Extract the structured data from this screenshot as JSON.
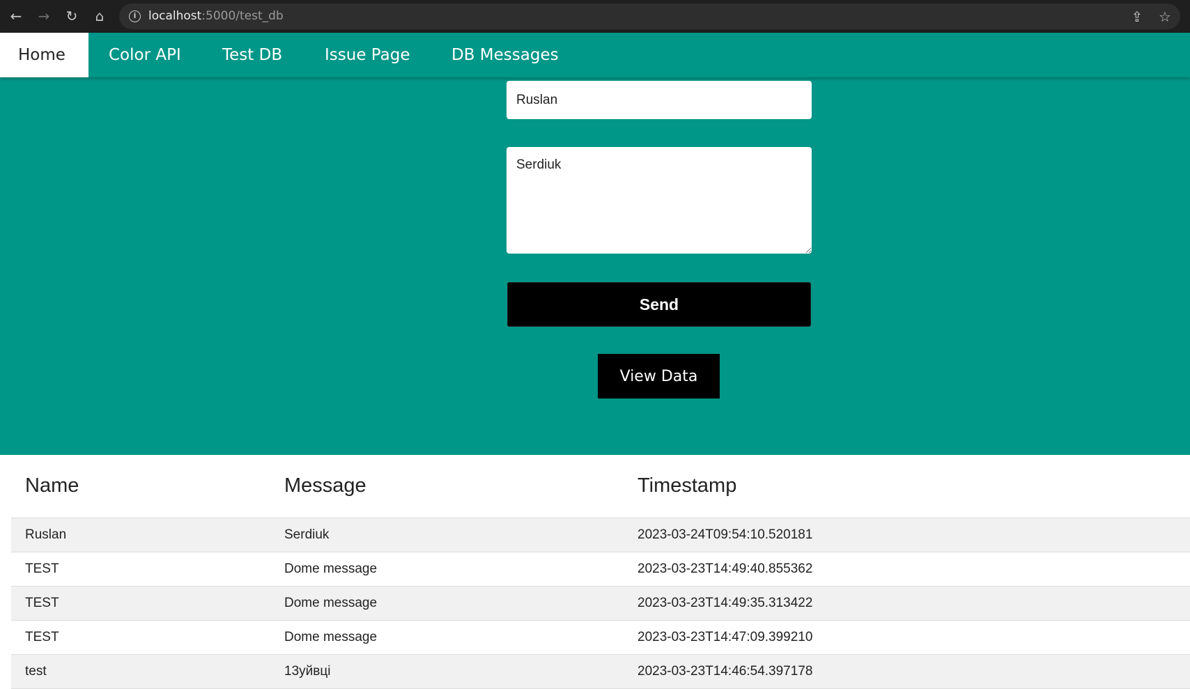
{
  "browser": {
    "url_host": "localhost",
    "url_path": ":5000/test_db"
  },
  "nav": {
    "items": [
      {
        "label": "Home"
      },
      {
        "label": "Color API"
      },
      {
        "label": "Test DB"
      },
      {
        "label": "Issue Page"
      },
      {
        "label": "DB Messages"
      }
    ]
  },
  "form": {
    "name_value": "Ruslan",
    "message_value": "Serdiuk",
    "send_label": "Send",
    "view_label": "View Data"
  },
  "table": {
    "headers": [
      "Name",
      "Message",
      "Timestamp"
    ],
    "rows": [
      [
        "Ruslan",
        "Serdiuk",
        "2023-03-24T09:54:10.520181"
      ],
      [
        "TEST",
        "Dome message",
        "2023-03-23T14:49:40.855362"
      ],
      [
        "TEST",
        "Dome message",
        "2023-03-23T14:49:35.313422"
      ],
      [
        "TEST",
        "Dome message",
        "2023-03-23T14:47:09.399210"
      ],
      [
        "test",
        "13уйвці",
        "2023-03-23T14:46:54.397178"
      ]
    ]
  },
  "colors": {
    "accent": "#009688",
    "button": "#000000"
  }
}
